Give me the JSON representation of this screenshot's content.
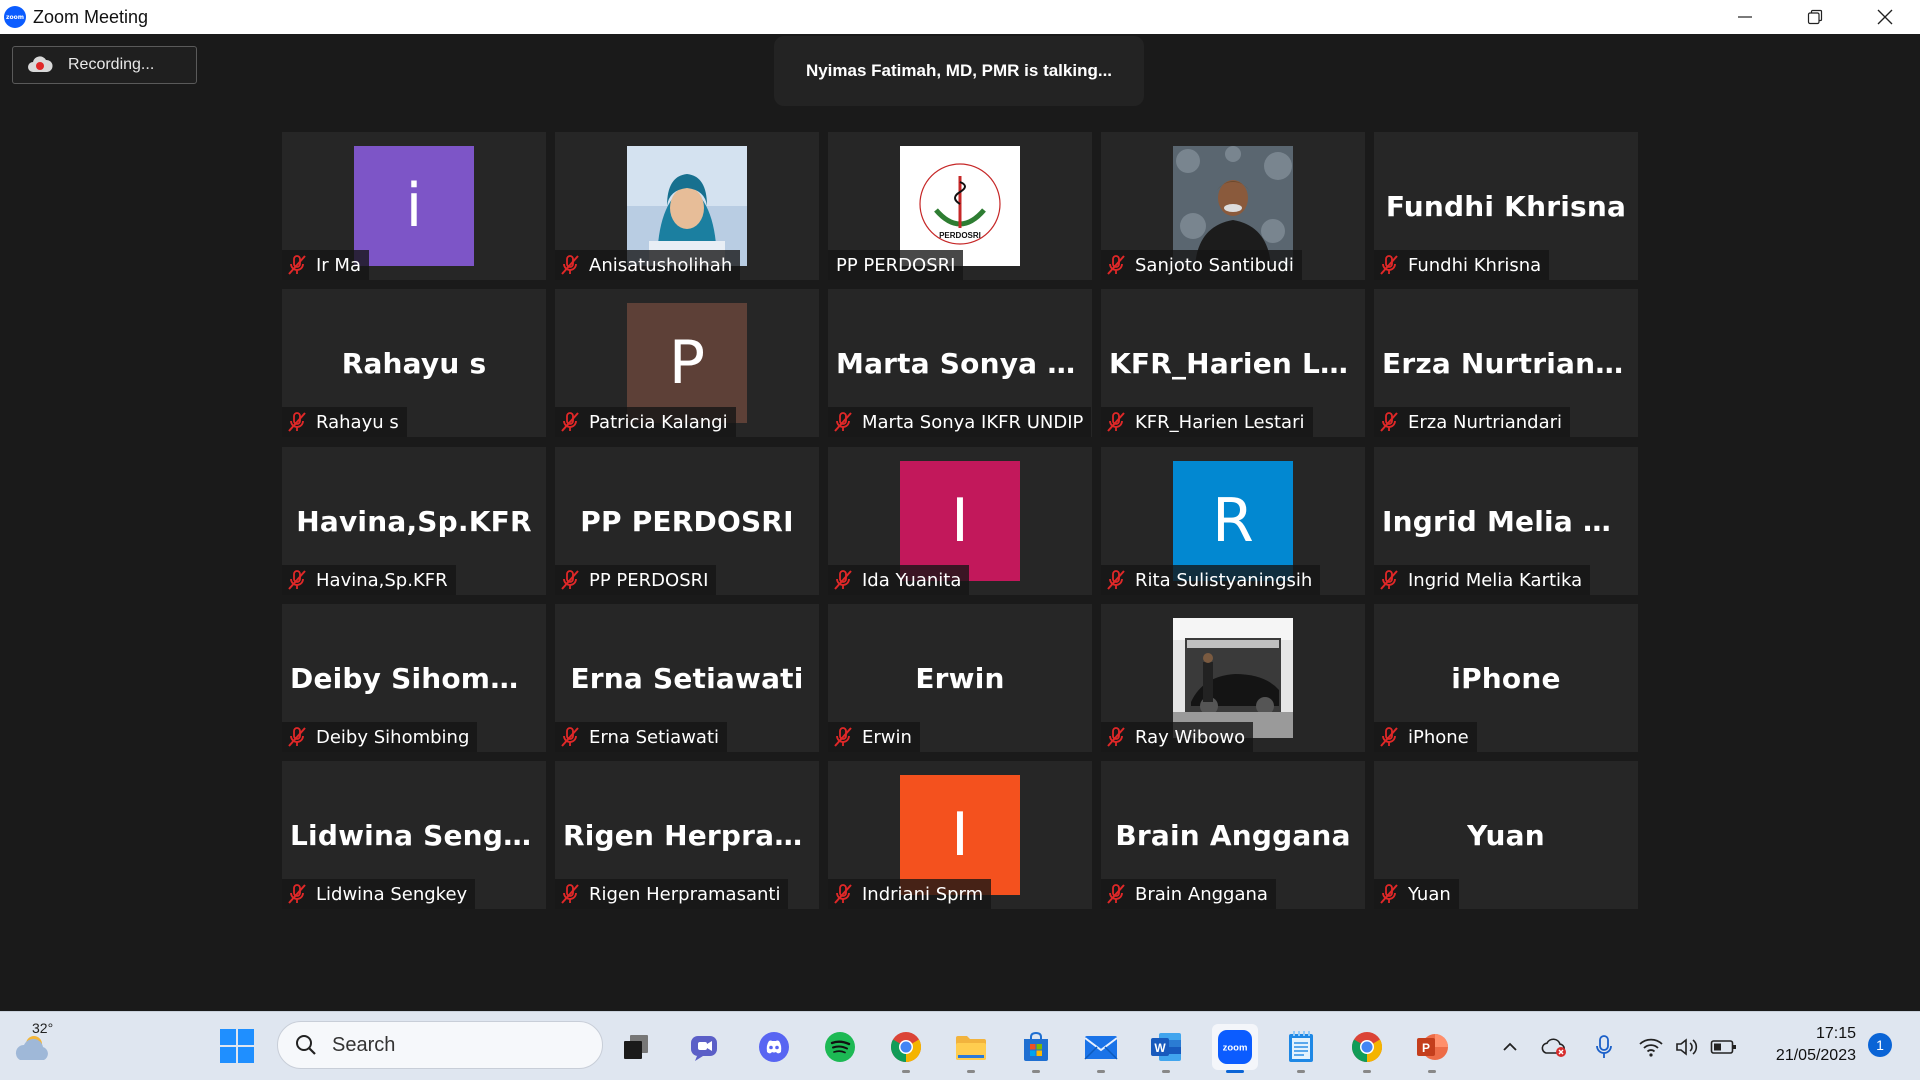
{
  "window": {
    "title": "Zoom Meeting",
    "app_icon_text": "zoom"
  },
  "meeting": {
    "recording_label": "Recording...",
    "talking_banner": "Nyimas Fatimah, MD, PMR is talking..."
  },
  "participants": [
    {
      "label": "Ir Ma",
      "display": "avatar",
      "avatar_letter": "i",
      "avatar_color": "#7d55c7",
      "muted": true
    },
    {
      "label": "Anisatusholihah",
      "display": "photo",
      "photo": "woman-hijab-photo",
      "muted": true
    },
    {
      "label": "PP PERDOSRI",
      "display": "photo",
      "photo": "perdosri-logo",
      "muted": false,
      "logo_text": "PERDOSRI"
    },
    {
      "label": "Sanjoto Santibudi",
      "display": "photo",
      "photo": "man-photo",
      "muted": true
    },
    {
      "label": "Fundhi Khrisna",
      "display": "name",
      "big_name": "Fundhi Khrisna",
      "muted": true
    },
    {
      "label": "Rahayu s",
      "display": "name",
      "big_name": "Rahayu s",
      "muted": true
    },
    {
      "label": "Patricia Kalangi",
      "display": "avatar",
      "avatar_letter": "P",
      "avatar_color": "#5d4037",
      "muted": true
    },
    {
      "label": "Marta Sonya IKFR UNDIP",
      "display": "name",
      "big_name": "Marta Sonya IK...",
      "muted": true
    },
    {
      "label": "KFR_Harien Lestari",
      "display": "name",
      "big_name": "KFR_Harien Les...",
      "muted": true
    },
    {
      "label": "Erza Nurtriandari",
      "display": "name",
      "big_name": "Erza Nurtriandari",
      "muted": true
    },
    {
      "label": "Havina,Sp.KFR",
      "display": "name",
      "big_name": "Havina,Sp.KFR",
      "muted": true
    },
    {
      "label": "PP PERDOSRI",
      "display": "name",
      "big_name": "PP PERDOSRI",
      "muted": true
    },
    {
      "label": "Ida Yuanita",
      "display": "avatar",
      "avatar_letter": "I",
      "avatar_color": "#c2185b",
      "muted": true
    },
    {
      "label": "Rita Sulistyaningsih",
      "display": "avatar",
      "avatar_letter": "R",
      "avatar_color": "#0288d1",
      "muted": true
    },
    {
      "label": "Ingrid Melia Kartika",
      "display": "name",
      "big_name": "Ingrid Melia Ka...",
      "muted": true
    },
    {
      "label": "Deiby Sihombing",
      "display": "name",
      "big_name": "Deiby Sihombing",
      "muted": true
    },
    {
      "label": "Erna Setiawati",
      "display": "name",
      "big_name": "Erna Setiawati",
      "muted": true
    },
    {
      "label": "Erwin",
      "display": "name",
      "big_name": "Erwin",
      "muted": true
    },
    {
      "label": "Ray Wibowo",
      "display": "photo",
      "photo": "car-photo",
      "muted": true
    },
    {
      "label": "iPhone",
      "display": "name",
      "big_name": "iPhone",
      "muted": true
    },
    {
      "label": "Lidwina Sengkey",
      "display": "name",
      "big_name": "Lidwina Sengkey",
      "muted": true
    },
    {
      "label": "Rigen Herpramasanti",
      "display": "name",
      "big_name": "Rigen Herpram...",
      "muted": true
    },
    {
      "label": "Indriani Sprm",
      "display": "avatar",
      "avatar_letter": "I",
      "avatar_color": "#f4511e",
      "muted": true
    },
    {
      "label": "Brain Anggana",
      "display": "name",
      "big_name": "Brain Anggana",
      "muted": true
    },
    {
      "label": "Yuan",
      "display": "name",
      "big_name": "Yuan",
      "muted": true
    }
  ],
  "taskbar": {
    "weather_temp": "32°",
    "search_placeholder": "Search",
    "apps": [
      {
        "name": "task-view",
        "icon": "task-view-icon"
      },
      {
        "name": "chat",
        "icon": "chat-icon"
      },
      {
        "name": "discord",
        "icon": "discord-icon"
      },
      {
        "name": "spotify",
        "icon": "spotify-icon"
      },
      {
        "name": "chrome",
        "icon": "chrome-icon"
      },
      {
        "name": "file-explorer",
        "icon": "folder-icon"
      },
      {
        "name": "microsoft-store",
        "icon": "store-icon"
      },
      {
        "name": "mail",
        "icon": "mail-icon"
      },
      {
        "name": "word",
        "icon": "word-icon"
      },
      {
        "name": "zoom",
        "icon": "zoom-icon",
        "active": true
      },
      {
        "name": "notepad",
        "icon": "notepad-icon"
      },
      {
        "name": "chrome-profile",
        "icon": "chrome-icon"
      },
      {
        "name": "powerpoint",
        "icon": "powerpoint-icon"
      }
    ],
    "clock_time": "17:15",
    "clock_date": "21/05/2023",
    "notification_count": "1"
  }
}
